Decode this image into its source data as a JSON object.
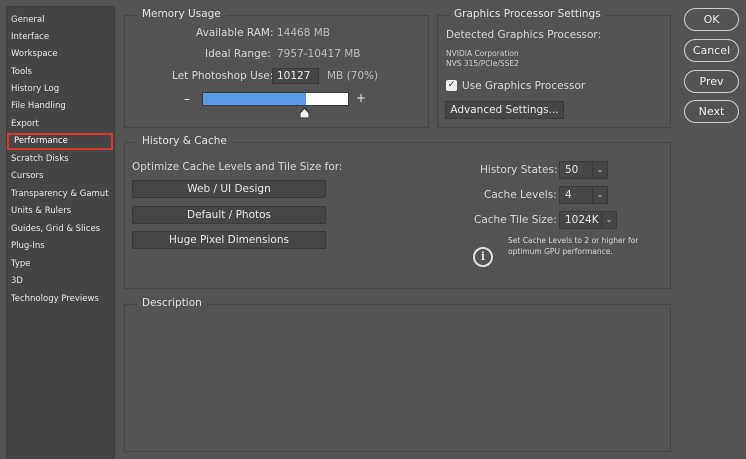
{
  "sidebar": {
    "items": [
      {
        "label": "General"
      },
      {
        "label": "Interface"
      },
      {
        "label": "Workspace"
      },
      {
        "label": "Tools"
      },
      {
        "label": "History Log"
      },
      {
        "label": "File Handling"
      },
      {
        "label": "Export"
      },
      {
        "label": "Performance",
        "selected": true
      },
      {
        "label": "Scratch Disks"
      },
      {
        "label": "Cursors"
      },
      {
        "label": "Transparency & Gamut"
      },
      {
        "label": "Units & Rulers"
      },
      {
        "label": "Guides, Grid & Slices"
      },
      {
        "label": "Plug-Ins"
      },
      {
        "label": "Type"
      },
      {
        "label": "3D"
      },
      {
        "label": "Technology Previews"
      }
    ]
  },
  "memory": {
    "title": "Memory Usage",
    "available_label": "Available RAM:",
    "available_value": "14468 MB",
    "ideal_label": "Ideal Range:",
    "ideal_value": "7957-10417 MB",
    "let_label": "Let Photoshop Use:",
    "let_value": "10127",
    "let_suffix": "MB (70%)",
    "slider_fraction": 0.7,
    "minus": "–",
    "plus": "+"
  },
  "gpu": {
    "title": "Graphics Processor Settings",
    "detected_label": "Detected Graphics Processor:",
    "gpu_line1": "NVIDIA Corporation",
    "gpu_line2": "NVS 315/PCIe/SSE2",
    "use_gpu_label": "Use Graphics Processor",
    "use_gpu_checked": true,
    "advanced_label": "Advanced Settings..."
  },
  "history": {
    "title": "History & Cache",
    "optimize_label": "Optimize Cache Levels and Tile Size for:",
    "btn_web": "Web / UI Design",
    "btn_default": "Default / Photos",
    "btn_huge": "Huge Pixel Dimensions",
    "states_label": "History States:",
    "states_value": "50",
    "levels_label": "Cache Levels:",
    "levels_value": "4",
    "tile_label": "Cache Tile Size:",
    "tile_value": "1024K",
    "info_line1": "Set Cache Levels to 2 or higher for",
    "info_line2": "optimum GPU performance."
  },
  "description": {
    "title": "Description"
  },
  "buttons": {
    "ok": "OK",
    "cancel": "Cancel",
    "prev": "Prev",
    "next": "Next"
  },
  "colors": {
    "accent": "#5b9be6",
    "selection_border": "#d33a2c"
  }
}
